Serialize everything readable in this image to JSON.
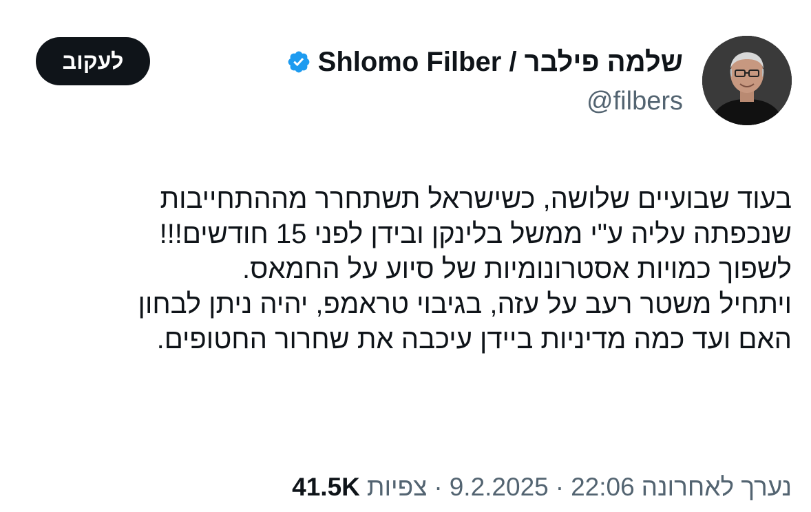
{
  "author": {
    "display_name": "שלמה פילבר / Shlomo Filber",
    "handle": "@filbers",
    "verified_icon": "verified-badge-icon",
    "verified_color": "#1d9bf0",
    "avatar_icon": "profile-photo"
  },
  "follow_button": {
    "label": "לעקוב"
  },
  "body": {
    "lines": [
      "בעוד שבועיים שלושה, כשישראל תשתחרר מההתחייבות",
      "שנכפתה עליה ע\"י ממשל בלינקן ובידן לפני 15 חודשים!!!",
      "לשפוך כמויות אסטרונומיות של סיוע על החמאס.",
      "ויתחיל משטר רעב על עזה, בגיבוי טראמפ, יהיה ניתן לבחון",
      "האם ועד כמה מדיניות ביידן עיכבה את שחרור החטופים."
    ]
  },
  "meta": {
    "edited_label": "נערך לאחרונה",
    "time": "22:06",
    "date": "9.2.2025",
    "separator": "·",
    "views_label": "צפיות",
    "views_count": "41.5K"
  },
  "colors": {
    "text_primary": "#0f1419",
    "text_secondary": "#536471",
    "button_bg": "#0f1419",
    "background": "#ffffff"
  }
}
